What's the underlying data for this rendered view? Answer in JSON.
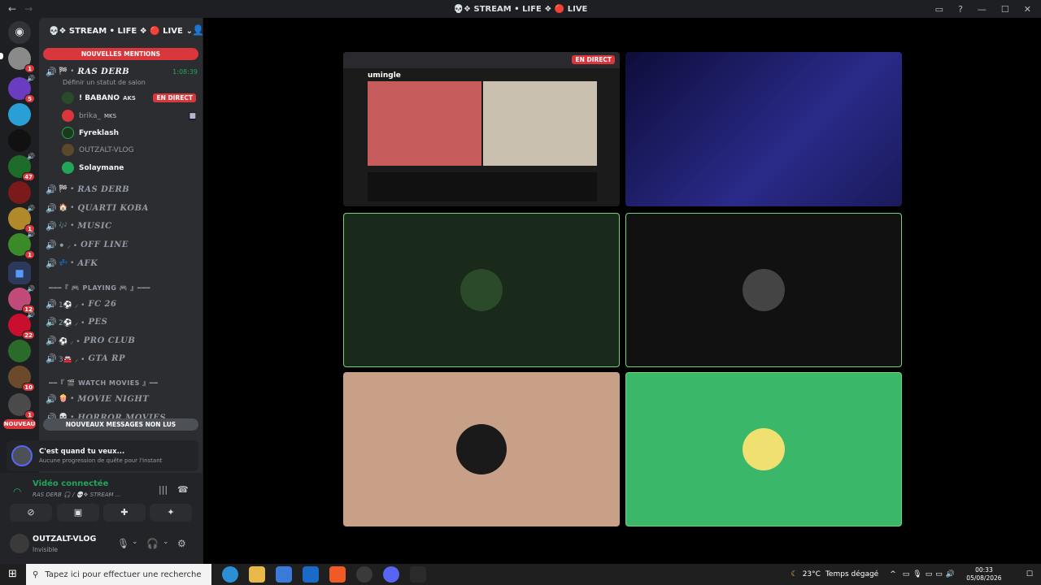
{
  "window": {
    "title": "💀❖ STREAM • LIFE ❖ 🔴 LIVE"
  },
  "servers": [
    {
      "color": "#8a8a8a",
      "badge": "1"
    },
    {
      "color": "#6b3cbf",
      "badge": "5"
    },
    {
      "color": "#2a9fd6",
      "badge": ""
    },
    {
      "color": "#111111",
      "badge": ""
    },
    {
      "color": "#1e6b2a",
      "badge": "47"
    },
    {
      "color": "#7a1a1a",
      "badge": ""
    },
    {
      "color": "#b08a2a",
      "badge": "1"
    },
    {
      "color": "#3a8a2a",
      "badge": "1"
    },
    {
      "color": "#1f6fd0",
      "badge": ""
    },
    {
      "color": "#c04a7a",
      "badge": "12"
    },
    {
      "color": "#c8102e",
      "badge": "22"
    },
    {
      "color": "#2a6a2a",
      "badge": ""
    },
    {
      "color": "#6a4a2a",
      "badge": "10"
    },
    {
      "color": "#4a4a4a",
      "badge": "1"
    }
  ],
  "nouveau_label": "NOUVEAU",
  "guild": {
    "name": "💀❖ STREAM • LIFE ❖ 🔴 LIVE",
    "mentions_banner": "NOUVELLES MENTIONS",
    "unread_banner": "NOUVEAUX MESSAGES NON LUS"
  },
  "active_channel": {
    "name": "RAS DERB",
    "time": "1:08:39",
    "status": "Définir un statut de salon"
  },
  "members": [
    {
      "name": "! BABANO",
      "tag": "AKS",
      "live": "EN DIRECT",
      "color": "#2a4a2a"
    },
    {
      "name": "brika_",
      "tag": "MKS",
      "color": "#da373c"
    },
    {
      "name": "Fyreklash",
      "tag": "",
      "color": "#1a3a1a"
    },
    {
      "name": "OUTZALT-VLOG",
      "tag": "",
      "color": "#5a4a2a"
    },
    {
      "name": "Solaymane",
      "tag": "",
      "color": "#23a559"
    }
  ],
  "voice_channels": [
    {
      "name": "RAS DERB",
      "prefix": "🏁 •"
    },
    {
      "name": "QUARTI KOBA",
      "prefix": "🏠 •"
    },
    {
      "name": "MUSIC",
      "prefix": "🎶 •"
    },
    {
      "name": "OFF LINE",
      "prefix": "⚫ ⸝ •"
    },
    {
      "name": "AFK",
      "prefix": "💤 •"
    }
  ],
  "category_playing": "━━━『 🎮 PLAYING 🎮 』━━━",
  "playing_channels": [
    {
      "name": "FC 26",
      "prefix": "1⚽ ⸝ •"
    },
    {
      "name": "PES",
      "prefix": "2⚽ ⸝ •"
    },
    {
      "name": "PRO CLUB",
      "prefix": "⚽ ⸝ •"
    },
    {
      "name": "GTA RP",
      "prefix": "3🚘 ⸝ •"
    }
  ],
  "category_movies": "━━『 🎬 WATCH MOVIES 』━━",
  "movie_channels": [
    {
      "name": "MOVIE NIGHT",
      "prefix": "🍿 •"
    },
    {
      "name": "HORROR MOVIES",
      "prefix": "💀 •"
    }
  ],
  "quest": {
    "title": "C'est quand tu veux...",
    "subtitle": "Aucune progression de quête pour l'instant"
  },
  "voice_panel": {
    "status": "Vidéo connectée",
    "location": "RAS DERB 🎧 / 💀❖ STREAM ..."
  },
  "user": {
    "name": "OUTZALT-VLOG",
    "status": "Invisible"
  },
  "stage": {
    "screen_live": "EN DIRECT",
    "screen_site": "umingle"
  },
  "taskbar": {
    "search_placeholder": "Tapez ici pour effectuer une recherche",
    "weather_temp": "23°C",
    "weather_desc": "Temps dégagé",
    "time": "00:33",
    "date": "05/08/2026"
  }
}
